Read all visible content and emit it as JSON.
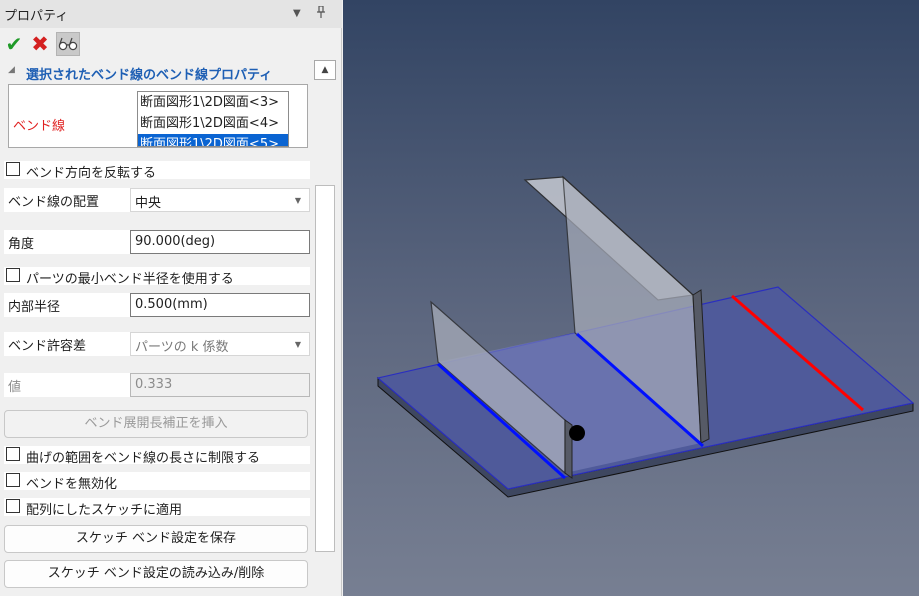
{
  "panel": {
    "title": "プロパティ",
    "section_title": "選択されたベンド線のベンド線プロパティ",
    "bend_line_label": "ベンド線",
    "bend_line_items": [
      "断面図形1\\2D図面<3>",
      "断面図形1\\2D図面<4>",
      "断面図形1\\2D図面<5>"
    ],
    "bend_line_selected_index": 2,
    "reverse_direction": {
      "label": "ベンド方向を反転する",
      "checked": false
    },
    "placement": {
      "label": "ベンド線の配置",
      "value": "中央"
    },
    "angle": {
      "label": "角度",
      "value": "90.000(deg)"
    },
    "use_min_radius": {
      "label": "パーツの最小ベンド半径を使用する",
      "checked": false
    },
    "inner_radius": {
      "label": "内部半径",
      "value": "0.500(mm)"
    },
    "tolerance": {
      "label": "ベンド許容差",
      "value": "パーツの k 係数"
    },
    "value": {
      "label": "値",
      "value": "0.333"
    },
    "insert_button": "ベンド展開長補正を挿入",
    "limit_curve": {
      "label": "曲げの範囲をベンド線の長さに制限する",
      "checked": false
    },
    "disable_bend": {
      "label": "ベンドを無効化",
      "checked": false
    },
    "apply_array": {
      "label": "配列にしたスケッチに適用",
      "checked": false
    },
    "save_button": "スケッチ ベンド設定を保存",
    "load_button": "スケッチ ベンド設定の読み込み/削除"
  },
  "icons": {
    "ok": "check-icon",
    "cancel": "close-icon",
    "preview": "glasses-icon"
  },
  "colors": {
    "ok": "#1f9a28",
    "cancel": "#d42020",
    "section_title": "#1e5fb4",
    "bend_line_label": "#e02020",
    "selection": "#0a64d2",
    "bend_line_blue": "#0010ff",
    "bend_line_red": "#ff0000"
  }
}
